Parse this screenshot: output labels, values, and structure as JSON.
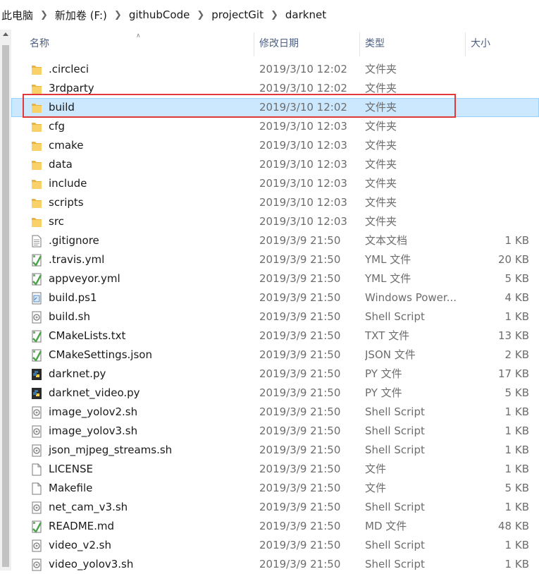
{
  "breadcrumb": [
    "此电脑",
    "新加卷 (F:)",
    "githubCode",
    "projectGit",
    "darknet"
  ],
  "columns": {
    "name": "名称",
    "date": "修改日期",
    "type": "类型",
    "size": "大小"
  },
  "colors": {
    "selected_bg": "#cce8ff",
    "highlight_border": "#e0383b",
    "folder": "#e8b440"
  },
  "files": [
    {
      "name": ".circleci",
      "date": "2019/3/10 12:02",
      "type": "文件夹",
      "size": "",
      "icon": "folder-icon"
    },
    {
      "name": "3rdparty",
      "date": "2019/3/10 12:02",
      "type": "文件夹",
      "size": "",
      "icon": "folder-icon"
    },
    {
      "name": "build",
      "date": "2019/3/10 12:02",
      "type": "文件夹",
      "size": "",
      "icon": "folder-icon",
      "selected": true
    },
    {
      "name": "cfg",
      "date": "2019/3/10 12:03",
      "type": "文件夹",
      "size": "",
      "icon": "folder-icon"
    },
    {
      "name": "cmake",
      "date": "2019/3/10 12:03",
      "type": "文件夹",
      "size": "",
      "icon": "folder-icon"
    },
    {
      "name": "data",
      "date": "2019/3/10 12:03",
      "type": "文件夹",
      "size": "",
      "icon": "folder-icon"
    },
    {
      "name": "include",
      "date": "2019/3/10 12:03",
      "type": "文件夹",
      "size": "",
      "icon": "folder-icon"
    },
    {
      "name": "scripts",
      "date": "2019/3/10 12:03",
      "type": "文件夹",
      "size": "",
      "icon": "folder-icon"
    },
    {
      "name": "src",
      "date": "2019/3/10 12:03",
      "type": "文件夹",
      "size": "",
      "icon": "folder-icon"
    },
    {
      "name": ".gitignore",
      "date": "2019/3/9 21:50",
      "type": "文本文档",
      "size": "1 KB",
      "icon": "text-file-icon"
    },
    {
      "name": ".travis.yml",
      "date": "2019/3/9 21:50",
      "type": "YML 文件",
      "size": "20 KB",
      "icon": "notepadpp-file-icon"
    },
    {
      "name": "appveyor.yml",
      "date": "2019/3/9 21:50",
      "type": "YML 文件",
      "size": "5 KB",
      "icon": "notepadpp-file-icon"
    },
    {
      "name": "build.ps1",
      "date": "2019/3/9 21:50",
      "type": "Windows Power...",
      "size": "4 KB",
      "icon": "powershell-file-icon"
    },
    {
      "name": "build.sh",
      "date": "2019/3/9 21:50",
      "type": "Shell Script",
      "size": "1 KB",
      "icon": "shell-script-icon"
    },
    {
      "name": "CMakeLists.txt",
      "date": "2019/3/9 21:50",
      "type": "TXT 文件",
      "size": "13 KB",
      "icon": "notepadpp-file-icon"
    },
    {
      "name": "CMakeSettings.json",
      "date": "2019/3/9 21:50",
      "type": "JSON 文件",
      "size": "2 KB",
      "icon": "notepadpp-file-icon"
    },
    {
      "name": "darknet.py",
      "date": "2019/3/9 21:50",
      "type": "PY 文件",
      "size": "17 KB",
      "icon": "python-file-icon"
    },
    {
      "name": "darknet_video.py",
      "date": "2019/3/9 21:50",
      "type": "PY 文件",
      "size": "5 KB",
      "icon": "python-file-icon"
    },
    {
      "name": "image_yolov2.sh",
      "date": "2019/3/9 21:50",
      "type": "Shell Script",
      "size": "1 KB",
      "icon": "shell-script-icon"
    },
    {
      "name": "image_yolov3.sh",
      "date": "2019/3/9 21:50",
      "type": "Shell Script",
      "size": "1 KB",
      "icon": "shell-script-icon"
    },
    {
      "name": "json_mjpeg_streams.sh",
      "date": "2019/3/9 21:50",
      "type": "Shell Script",
      "size": "1 KB",
      "icon": "shell-script-icon"
    },
    {
      "name": "LICENSE",
      "date": "2019/3/9 21:50",
      "type": "文件",
      "size": "1 KB",
      "icon": "blank-file-icon"
    },
    {
      "name": "Makefile",
      "date": "2019/3/9 21:50",
      "type": "文件",
      "size": "5 KB",
      "icon": "blank-file-icon"
    },
    {
      "name": "net_cam_v3.sh",
      "date": "2019/3/9 21:50",
      "type": "Shell Script",
      "size": "1 KB",
      "icon": "shell-script-icon"
    },
    {
      "name": "README.md",
      "date": "2019/3/9 21:50",
      "type": "MD 文件",
      "size": "48 KB",
      "icon": "notepadpp-file-icon"
    },
    {
      "name": "video_v2.sh",
      "date": "2019/3/9 21:50",
      "type": "Shell Script",
      "size": "1 KB",
      "icon": "shell-script-icon"
    },
    {
      "name": "video_yolov3.sh",
      "date": "2019/3/9 21:50",
      "type": "Shell Script",
      "size": "1 KB",
      "icon": "shell-script-icon"
    }
  ]
}
